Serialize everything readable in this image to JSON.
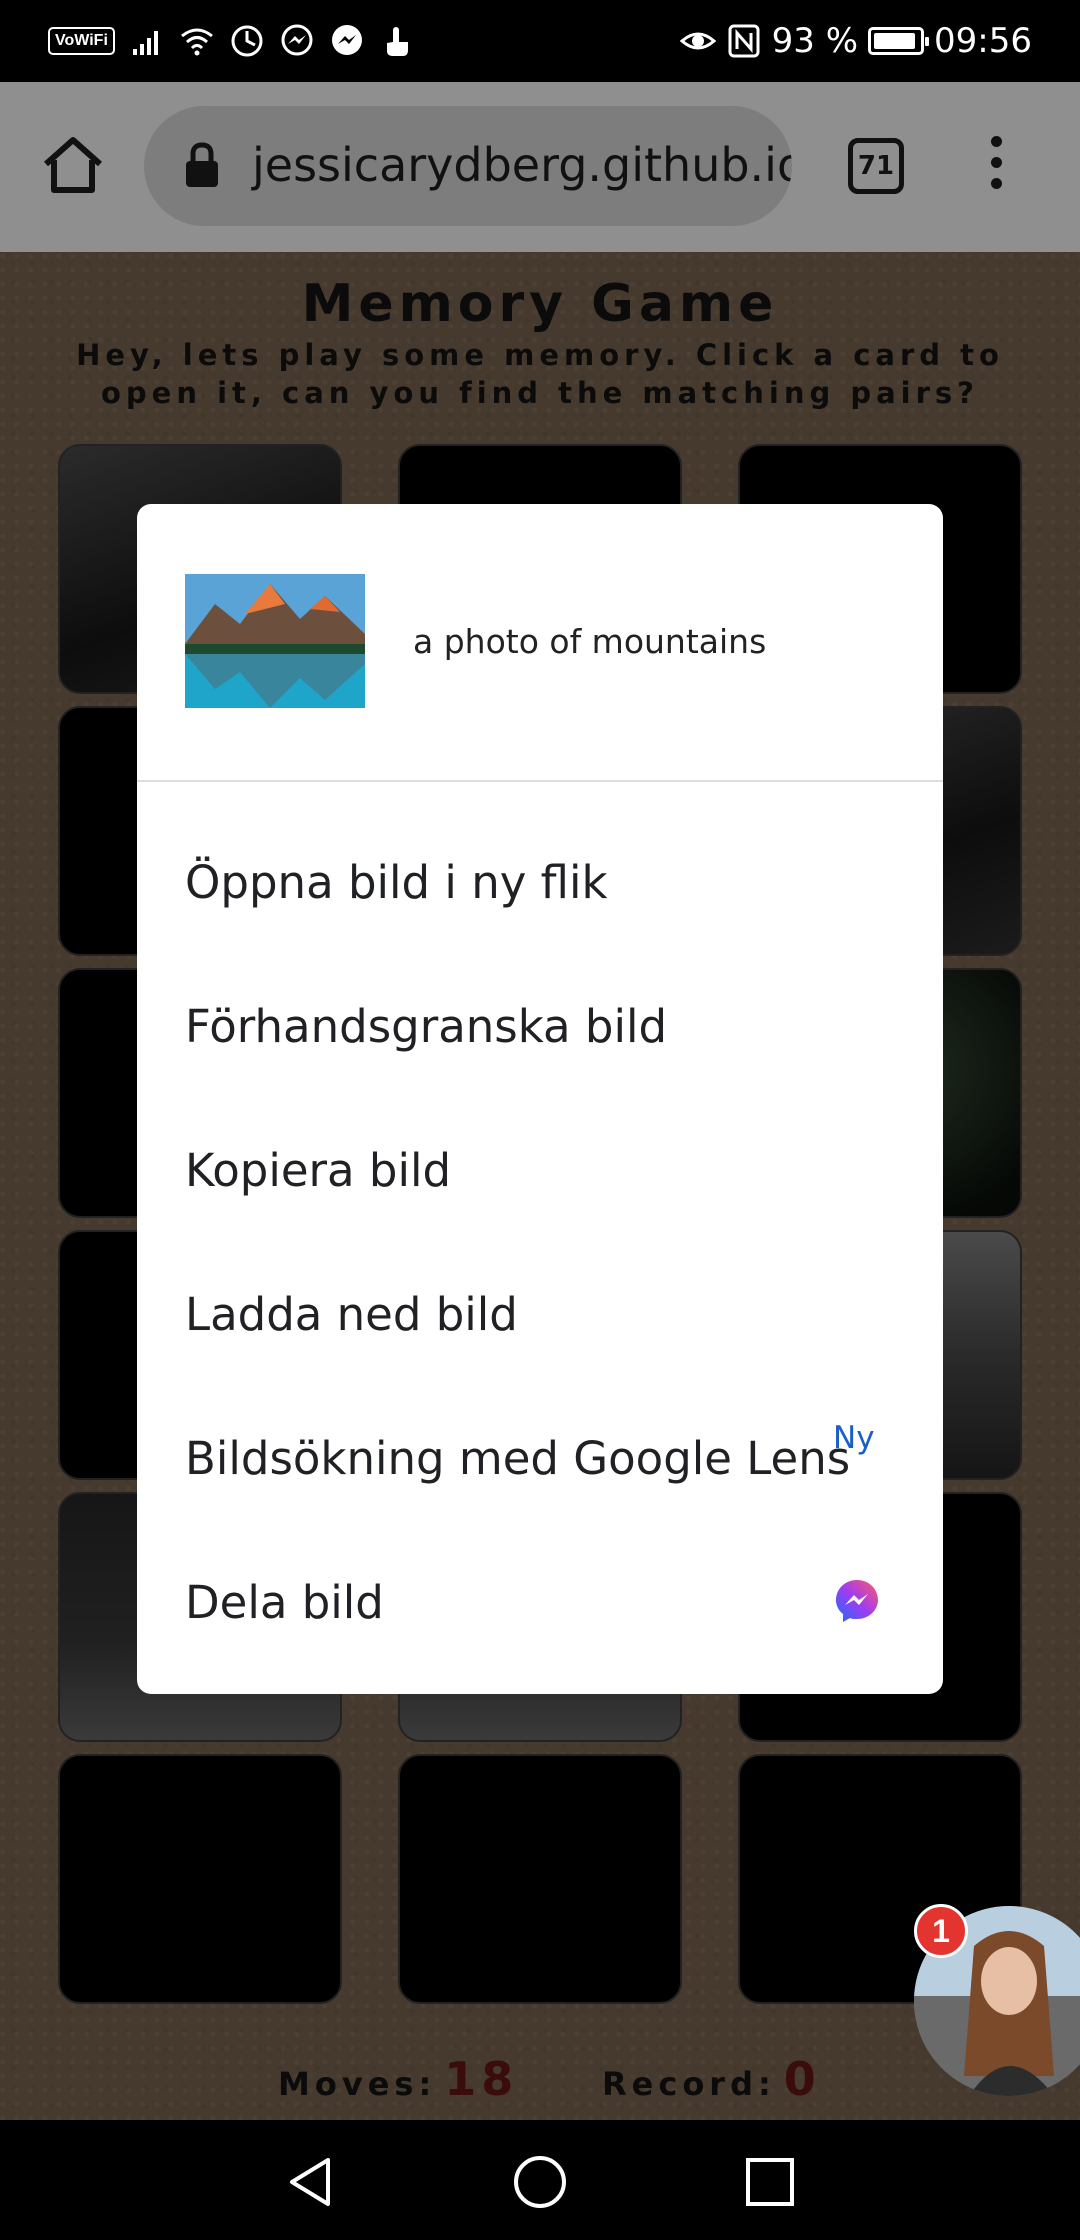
{
  "status_bar": {
    "vowifi_label": "VoWiFi",
    "battery_percent": "93 %",
    "battery_level": 0.93,
    "time": "09:56",
    "icons": [
      "signal-icon",
      "wifi-icon",
      "data-saver-icon",
      "messenger-icon",
      "messenger-icon",
      "touch-icon",
      "eye-comfort-icon",
      "nfc-icon",
      "battery-icon"
    ]
  },
  "browser": {
    "url": "jessicarydberg.github.io/",
    "tab_count": "71",
    "icons": [
      "home-icon",
      "lock-icon",
      "more-vert-icon"
    ]
  },
  "game": {
    "title": "Memory Game",
    "subtitle": "Hey, lets play some memory. Click a card to open it, can you find the matching pairs?",
    "moves_label": "Moves:",
    "moves_value": "18",
    "record_label": "Record:",
    "record_value": "0"
  },
  "context_menu": {
    "image_alt": "a photo of mountains",
    "items": [
      {
        "label": "Öppna bild i ny flik"
      },
      {
        "label": "Förhandsgranska bild"
      },
      {
        "label": "Kopiera bild"
      },
      {
        "label": "Ladda ned bild"
      },
      {
        "label": "Bildsökning med Google Lens",
        "badge": "Ny"
      },
      {
        "label": "Dela bild",
        "icon": "messenger-icon"
      }
    ]
  },
  "chat_head": {
    "badge_count": "1"
  },
  "colors": {
    "accent_blue": "#1a5fc7",
    "badge_red": "#e4342f",
    "score_value": "#3a0c0c"
  }
}
